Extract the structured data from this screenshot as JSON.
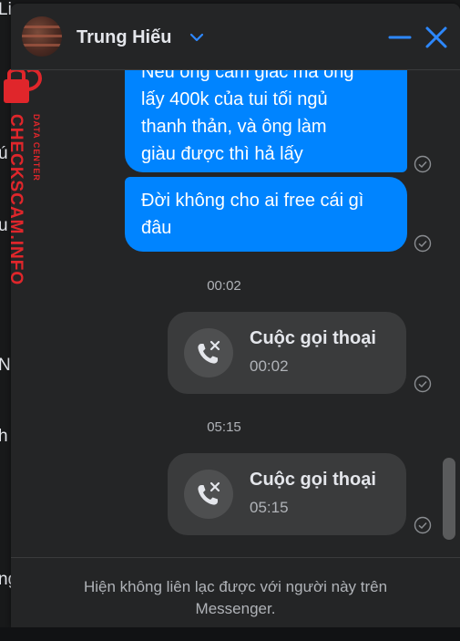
{
  "background": {
    "fragments": [
      "Li",
      "ú",
      "u",
      "N",
      "h",
      "ng"
    ]
  },
  "watermark": {
    "brand": "CHECKSCAM.INFO",
    "sub": "DATA CENTER",
    "color": "#e0262b"
  },
  "header": {
    "contact_name": "Trung Hiếu",
    "accent": "#0084ff"
  },
  "messages": [
    {
      "lines": [
        "Nếu ông cảm giác mà ông",
        "lấy 400k của tui tối ngủ",
        "thanh thản, và ông làm",
        "giàu được thì hả lấy"
      ]
    },
    {
      "lines": [
        "Đời không cho ai free cái gì",
        "đâu"
      ]
    }
  ],
  "calls": [
    {
      "separator": "00:02",
      "title": "Cuộc gọi thoại",
      "time": "00:02"
    },
    {
      "separator": "05:15",
      "title": "Cuộc gọi thoại",
      "time": "05:15"
    }
  ],
  "footer": {
    "notice": "Hiện không liên lạc được với người này trên Messenger."
  }
}
